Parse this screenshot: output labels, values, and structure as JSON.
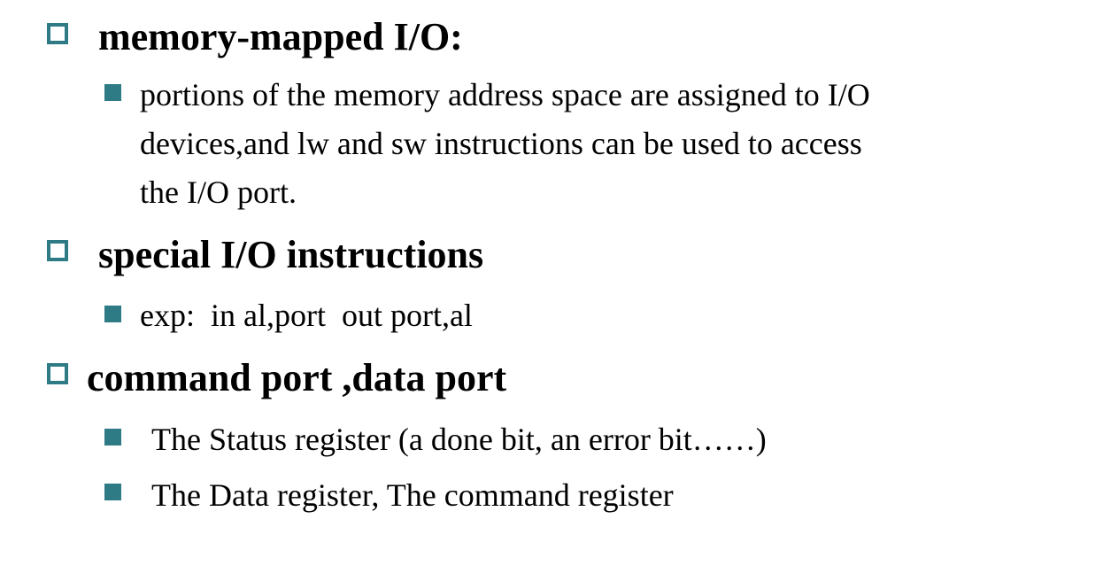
{
  "accent_color": "#2e7b86",
  "sections": [
    {
      "heading": "memory-mapped I/O:",
      "items": [
        {
          "lines": [
            "portions of the memory address space are assigned to I/O",
            "devices,and lw and sw instructions can be used to access",
            "the I/O port."
          ]
        }
      ]
    },
    {
      "heading": "special I/O instructions",
      "items": [
        {
          "lines": [
            "exp:  in al,port  out port,al"
          ]
        }
      ]
    },
    {
      "heading": "command port ,data port",
      "items": [
        {
          "lines": [
            "The Status register (a done bit, an error bit……)"
          ]
        },
        {
          "lines": [
            "The Data register, The command register"
          ]
        }
      ]
    }
  ]
}
